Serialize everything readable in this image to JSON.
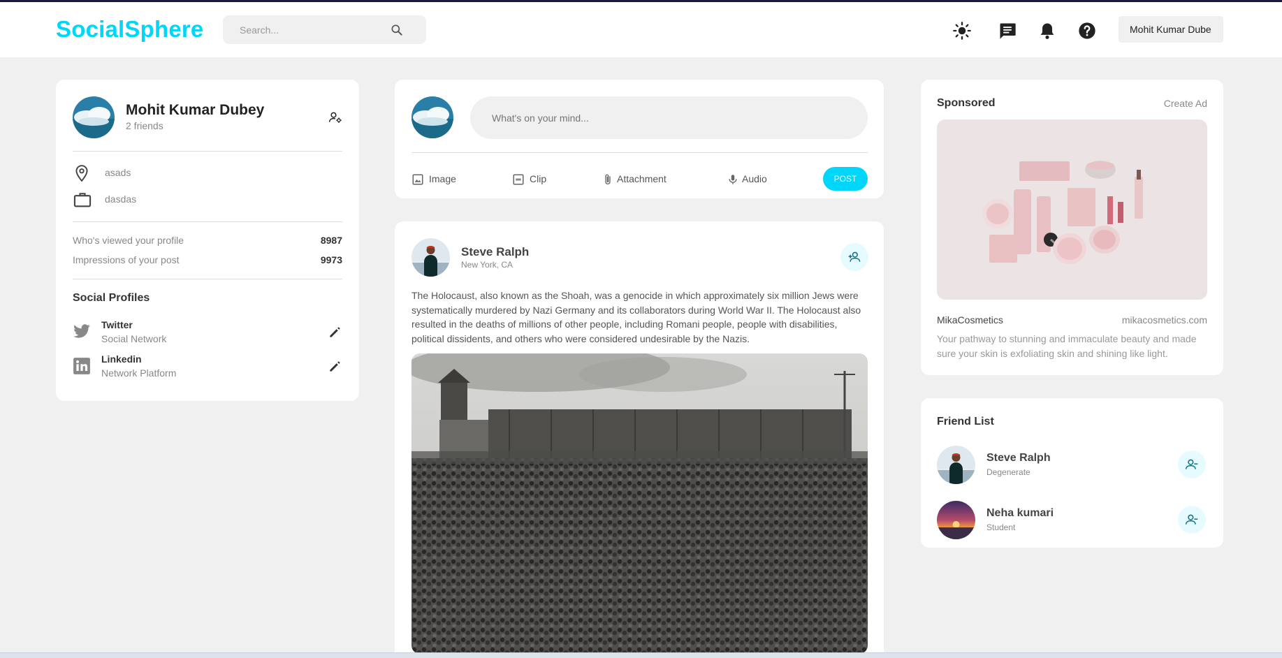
{
  "app": {
    "logo": "SocialSphere",
    "accent": "#00d5fa"
  },
  "header": {
    "search_placeholder": "Search...",
    "icons": [
      "sun-icon",
      "message-icon",
      "bell-icon",
      "help-icon"
    ],
    "user_name": "Mohit Kumar Dube"
  },
  "profile": {
    "name": "Mohit Kumar Dubey",
    "friends": "2 friends",
    "location": "asads",
    "occupation": "dasdas",
    "stats": [
      {
        "label": "Who's viewed your profile",
        "value": "8987"
      },
      {
        "label": "Impressions of your post",
        "value": "9973"
      }
    ],
    "social_title": "Social Profiles",
    "socials": [
      {
        "name": "Twitter",
        "type": "Social Network"
      },
      {
        "name": "Linkedin",
        "type": "Network Platform"
      }
    ]
  },
  "composer": {
    "placeholder": "What's on your mind...",
    "actions": [
      "Image",
      "Clip",
      "Attachment",
      "Audio"
    ],
    "post_label": "POST"
  },
  "post": {
    "author": "Steve Ralph",
    "location": "New York, CA",
    "lines": [
      "The Holocaust, also known as the Shoah, was a genocide in which approximately six million Jews were",
      "systematically murdered by Nazi Germany and its collaborators during World War II. The Holocaust also",
      "resulted in the deaths of millions of other people, including Romani people, people with disabilities,",
      "political dissidents, and others who were considered undesirable by the Nazis."
    ]
  },
  "sponsored": {
    "title": "Sponsored",
    "create_ad": "Create Ad",
    "brand": "MikaCosmetics",
    "site": "mikacosmetics.com",
    "desc_lines": [
      "Your pathway to stunning and immaculate beauty and made",
      "sure your skin is exfoliating skin and shining like light."
    ]
  },
  "friends": {
    "title": "Friend List",
    "items": [
      {
        "name": "Steve Ralph",
        "subtitle": "Degenerate"
      },
      {
        "name": "Neha kumari",
        "subtitle": "Student"
      }
    ]
  }
}
